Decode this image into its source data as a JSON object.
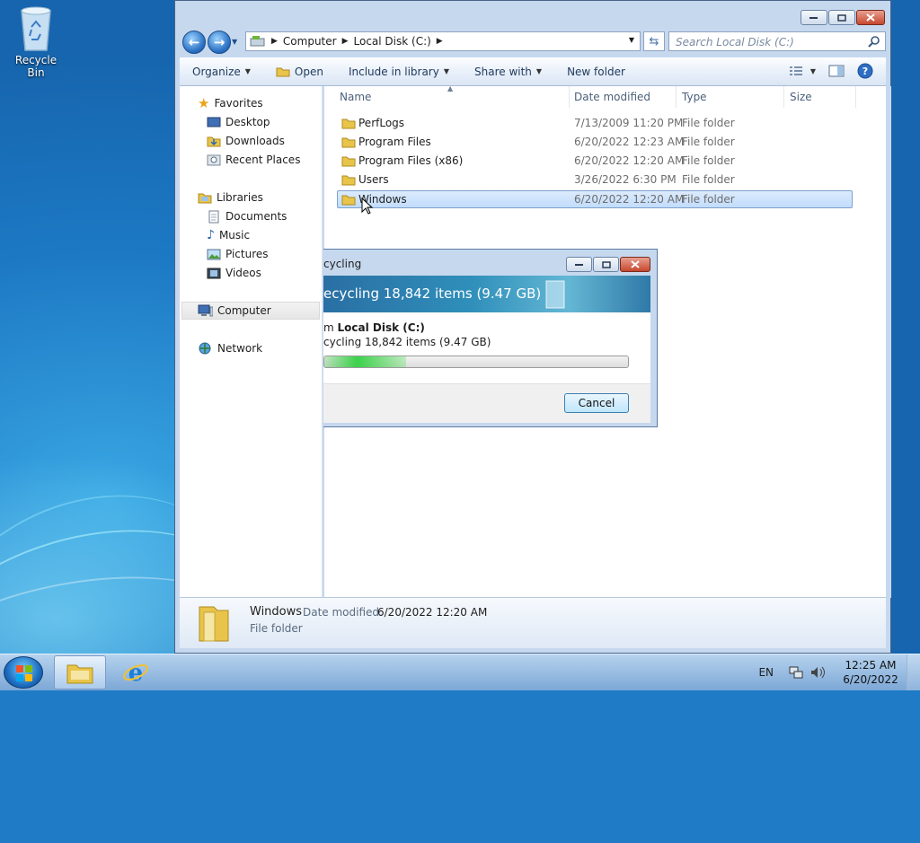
{
  "desktop": {
    "recycle_bin_label": "Recycle Bin"
  },
  "explorer": {
    "breadcrumb": [
      "Computer",
      "Local Disk (C:)"
    ],
    "search_placeholder": "Search Local Disk (C:)",
    "toolbar": {
      "organize": "Organize",
      "open": "Open",
      "include_in_library": "Include in library",
      "share_with": "Share with",
      "new_folder": "New folder"
    },
    "nav": {
      "favorites": "Favorites",
      "desktop": "Desktop",
      "downloads": "Downloads",
      "recent_places": "Recent Places",
      "libraries": "Libraries",
      "documents": "Documents",
      "music": "Music",
      "pictures": "Pictures",
      "videos": "Videos",
      "computer": "Computer",
      "network": "Network"
    },
    "columns": {
      "name": "Name",
      "date_modified": "Date modified",
      "type": "Type",
      "size": "Size"
    },
    "files": [
      {
        "name": "PerfLogs",
        "date": "7/13/2009 11:20 PM",
        "type": "File folder"
      },
      {
        "name": "Program Files",
        "date": "6/20/2022 12:23 AM",
        "type": "File folder"
      },
      {
        "name": "Program Files (x86)",
        "date": "6/20/2022 12:20 AM",
        "type": "File folder"
      },
      {
        "name": "Users",
        "date": "3/26/2022 6:30 PM",
        "type": "File folder"
      },
      {
        "name": "Windows",
        "date": "6/20/2022 12:20 AM",
        "type": "File folder"
      }
    ],
    "details": {
      "name": "Windows",
      "date_label": "Date modified:",
      "date_value": "6/20/2022 12:20 AM",
      "type": "File folder"
    }
  },
  "dialog": {
    "title": "cycling",
    "band_text": "ecycling 18,842 items (9.47 GB)",
    "from_prefix": "m ",
    "from_location": "Local Disk (C:)",
    "status": "cycling 18,842 items (9.47 GB)",
    "progress_fraction": 0.27,
    "cancel_label": "Cancel"
  },
  "taskbar": {
    "language": "EN",
    "time": "12:25 AM",
    "date": "6/20/2022"
  }
}
